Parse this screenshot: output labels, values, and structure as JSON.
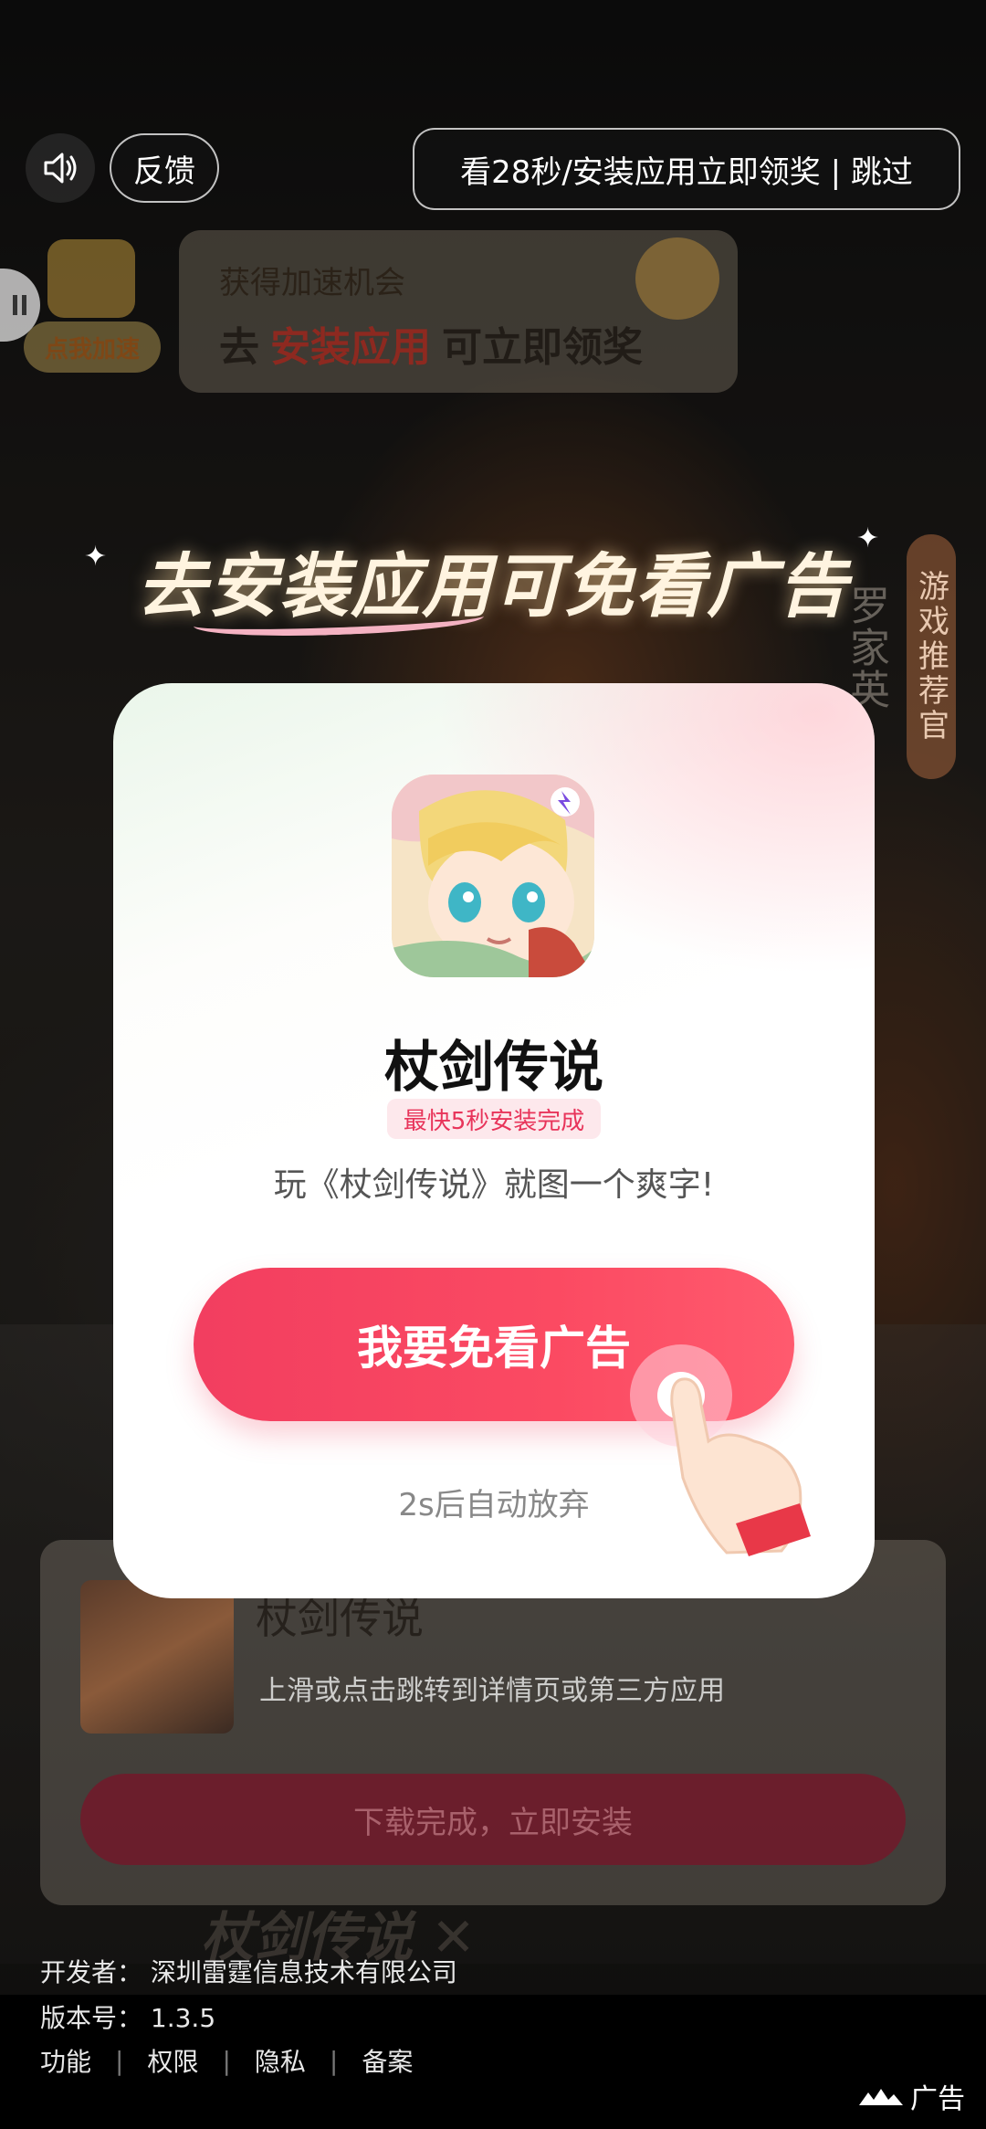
{
  "top_bar": {
    "sound_icon": "speaker-icon",
    "feedback_label": "反馈",
    "skip_label": "看28秒/安装应用立即领奖 | 跳过"
  },
  "speed_banner": {
    "pill_label": "点我加速",
    "title": "获得加速机会",
    "line_prefix": "去",
    "line_accent": "安装应用",
    "line_suffix": "可立即领奖"
  },
  "headline": {
    "part1": "去",
    "part2": "安装应用",
    "part3": "可免看广告"
  },
  "side": {
    "tag": "游戏推荐官",
    "vertical_text": "罗家英"
  },
  "modal": {
    "app_name": "杖剑传说",
    "install_tag": "最快5秒安装完成",
    "slogan": "玩《杖剑传说》就图一个爽字!",
    "cta_label": "我要免看广告",
    "auto_dismiss": "2s后自动放弃"
  },
  "download_card": {
    "title": "杖剑传说",
    "subtitle": "上滑或点击跳转到详情页或第三方应用",
    "button_label": "下载完成，立即安装"
  },
  "footer": {
    "developer": "开发者：  深圳雷霆信息技术有限公司",
    "version": "版本号：  1.3.5",
    "links": [
      "功能",
      "权限",
      "隐私",
      "备案"
    ],
    "ad_label": "广告"
  },
  "colors": {
    "cta": "#f23e60",
    "tag_text": "#e8345a",
    "tag_bg": "#fde8ec"
  }
}
